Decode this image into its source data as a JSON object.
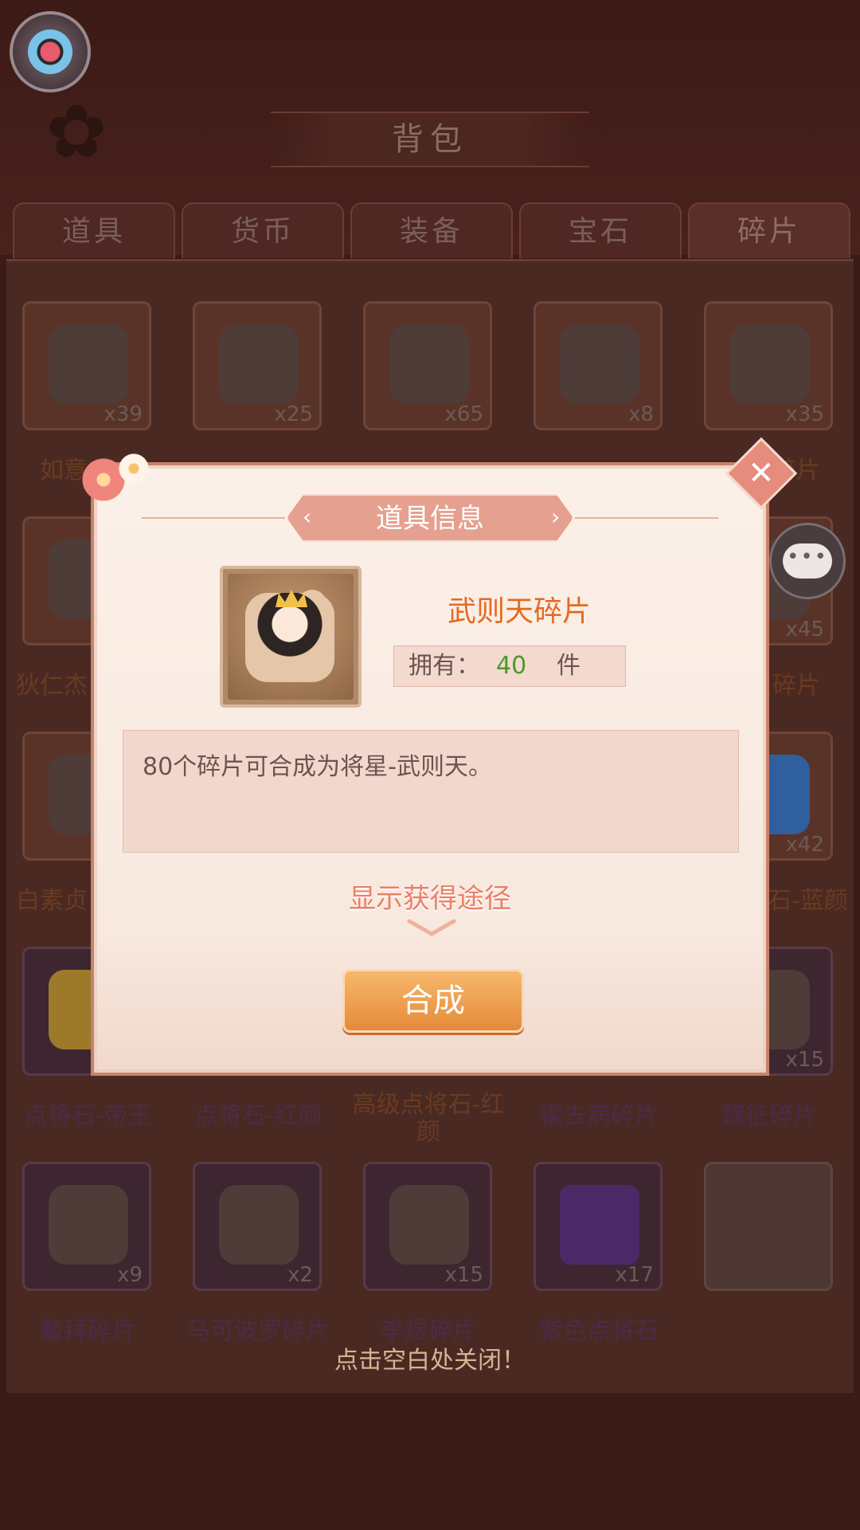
{
  "header": {
    "title": "背包"
  },
  "tabs": [
    "道具",
    "货币",
    "装备",
    "宝石",
    "碎片"
  ],
  "active_tab": 4,
  "grid": {
    "counts": [
      "x39",
      "x25",
      "x65",
      "x8",
      "x35",
      "x45",
      "x42",
      "x15",
      "x9",
      "x2",
      "x15",
      "x17"
    ],
    "labels_visible": [
      "如意",
      "碎片",
      "狄仁杰",
      "碎片",
      "白素贞",
      "石-蓝颜",
      "点将石-帝王",
      "点将石-红颜",
      "高级点将石-红颜",
      "霍去病碎片",
      "魏征碎片",
      "鳌拜碎片",
      "马可波罗碎片",
      "李煜碎片",
      "紫色点将石"
    ]
  },
  "modal": {
    "title": "道具信息",
    "item_name": "武则天碎片",
    "owned_label": "拥有：",
    "owned_value": "40",
    "owned_unit": "件",
    "description": "80个碎片可合成为将星-武则天。",
    "show_source": "显示获得途径",
    "compose_button": "合成"
  },
  "close_hint": "点击空白处关闭！",
  "colors": {
    "accent": "#e58c7c",
    "item_name": "#e46a20",
    "owned_value": "#4a9a2a",
    "button": "#e58a3b"
  },
  "icons": {
    "settings": "settings-icon",
    "logo": "sakura-icon",
    "chat": "chat-icon",
    "close": "close-icon",
    "chevron": "chevron-down-icon"
  }
}
